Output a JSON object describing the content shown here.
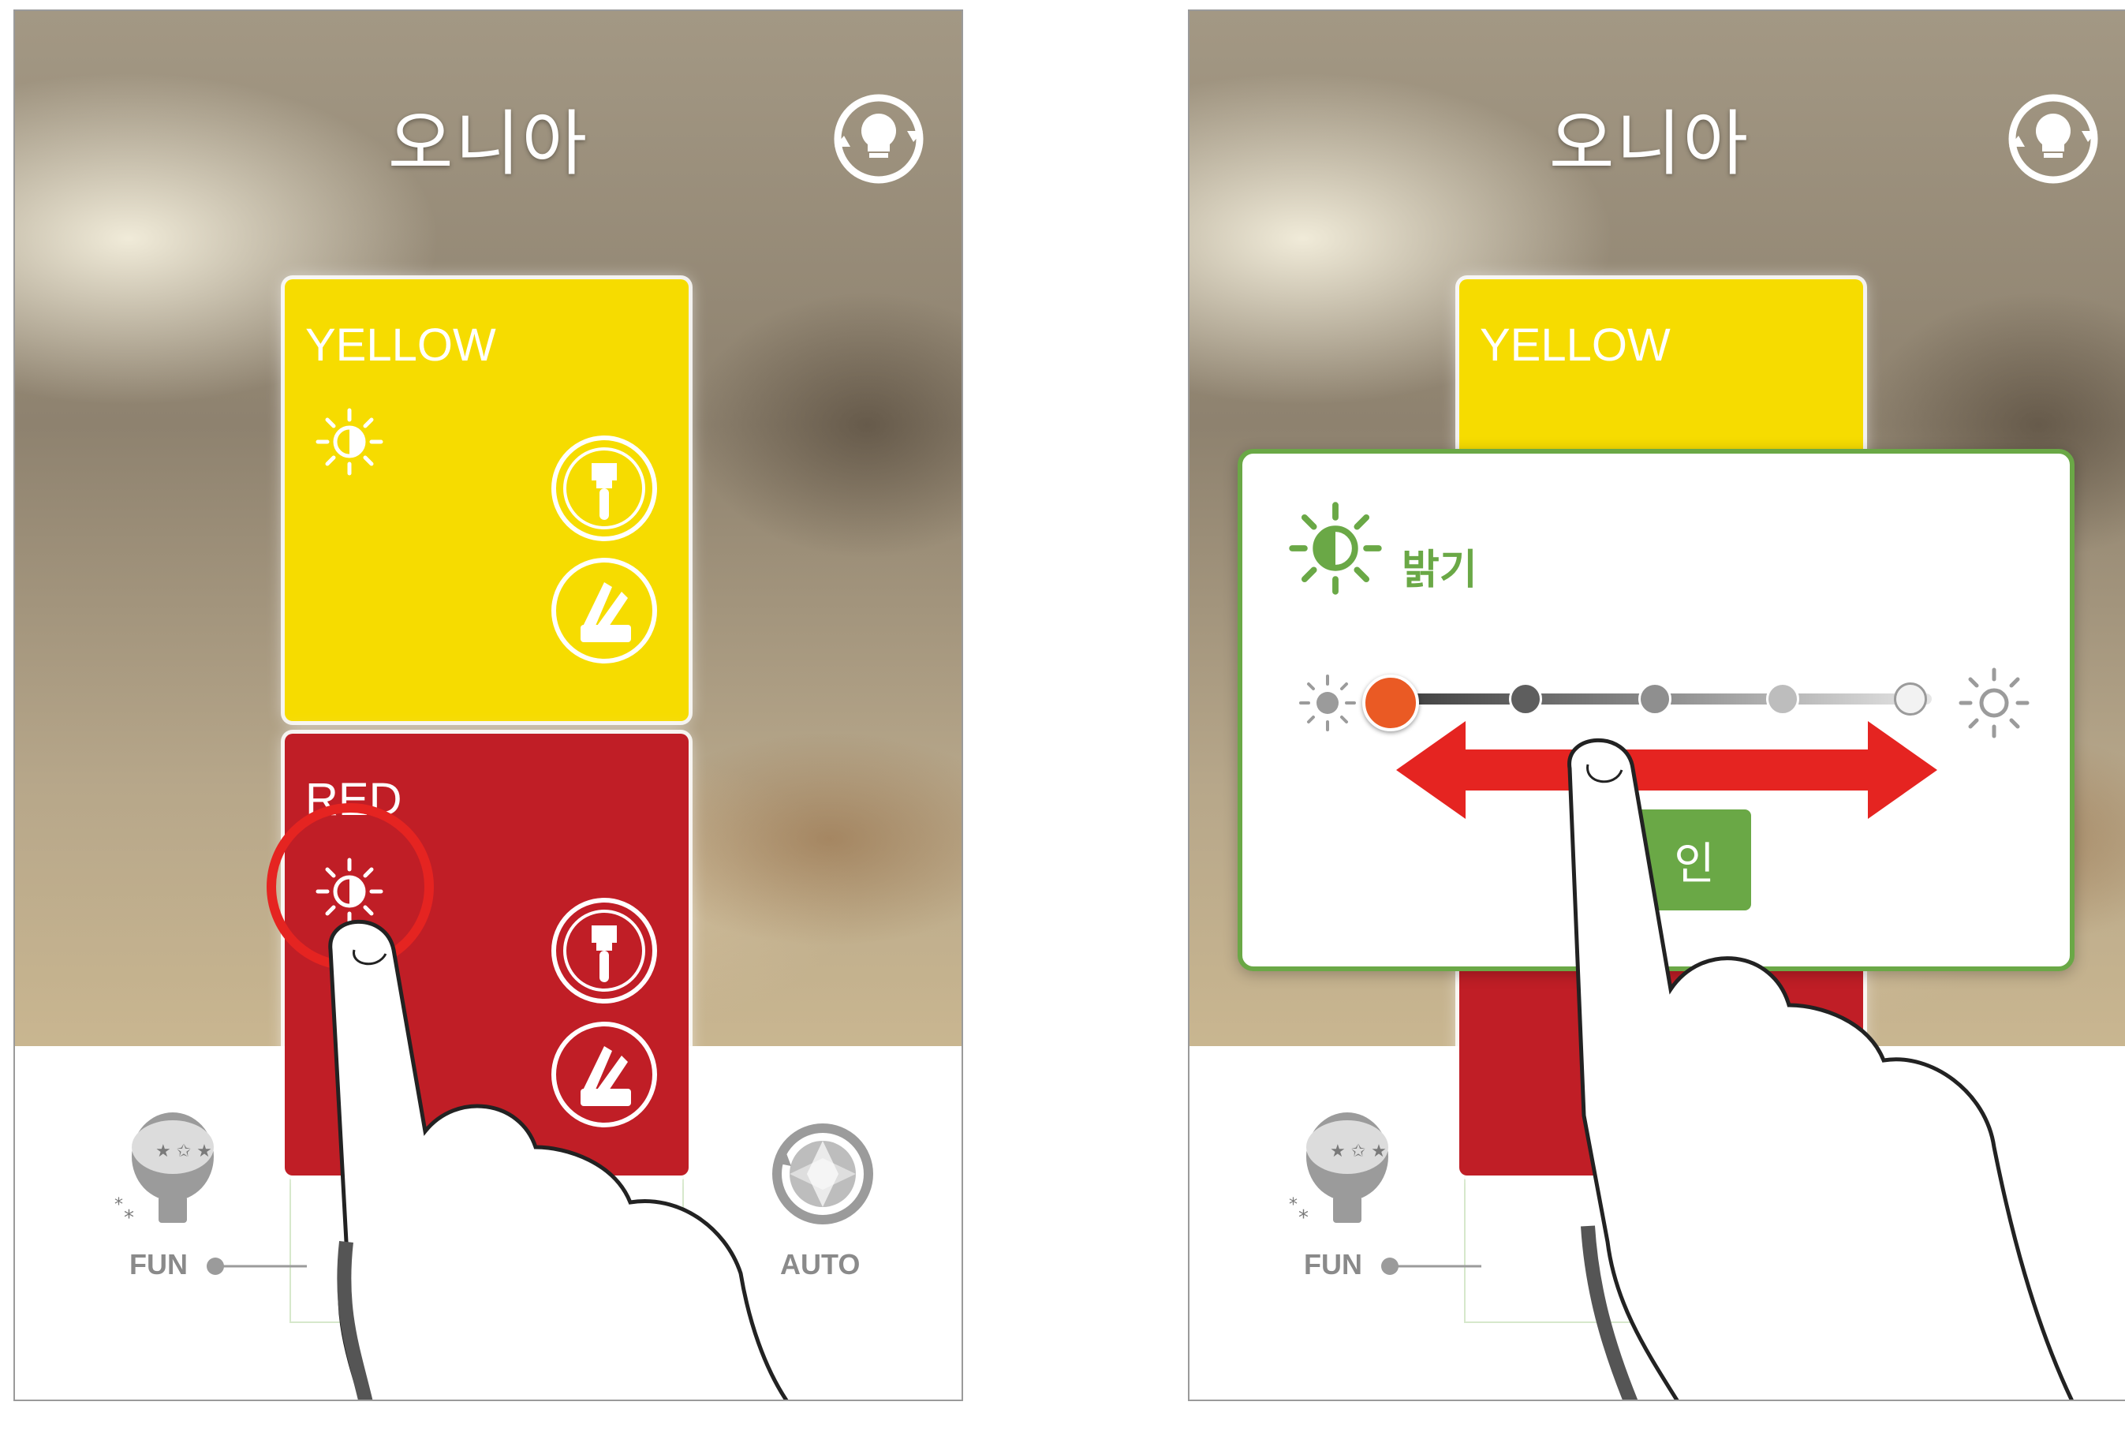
{
  "panels": [
    {
      "title": "오니아",
      "cards": [
        {
          "name": "YELLOW",
          "color": "#f6dc00"
        },
        {
          "name": "RED",
          "color": "#c01e26"
        }
      ],
      "modes": {
        "fun_label": "FUN",
        "auto_label": "AUTO"
      },
      "highlight": "brightness-icon-on-red-card"
    },
    {
      "title": "오니아",
      "cards": [
        {
          "name": "YELLOW",
          "color": "#f6dc00"
        }
      ],
      "modes": {
        "fun_label": "FUN"
      },
      "popup": {
        "title": "밝기",
        "confirm_label": "인",
        "slider_stops": 5,
        "slider_value": 0,
        "accent": "#6aa846"
      }
    }
  ],
  "colors": {
    "accent_green": "#6aa846",
    "thumb_orange": "#ea5a24",
    "arrow_red": "#e52421"
  }
}
